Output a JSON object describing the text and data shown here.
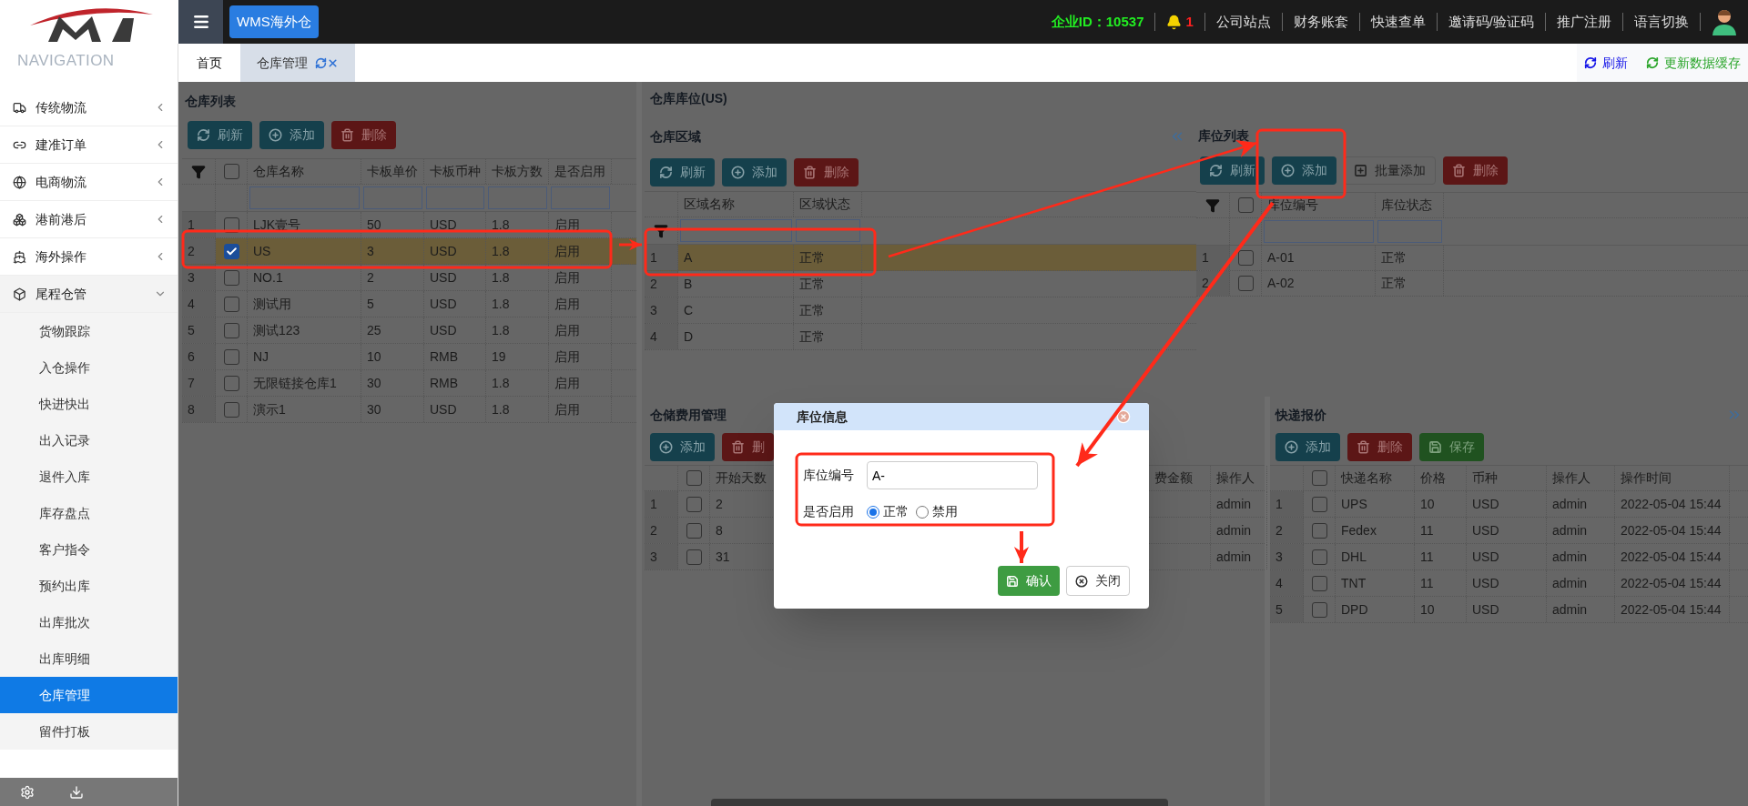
{
  "header": {
    "app_button": "WMS海外仓",
    "company_id": "企业ID：10537",
    "alert_count": "1",
    "links": [
      "公司站点",
      "财务账套",
      "快速查单",
      "邀请码/验证码",
      "推广注册",
      "语言切换"
    ]
  },
  "sidebar": {
    "title": "NAVIGATION",
    "items": [
      {
        "label": "传统物流",
        "expanded": false
      },
      {
        "label": "建准订单",
        "expanded": false
      },
      {
        "label": "电商物流",
        "expanded": false
      },
      {
        "label": "港前港后",
        "expanded": false
      },
      {
        "label": "海外操作",
        "expanded": false
      },
      {
        "label": "尾程仓管",
        "expanded": true,
        "children": [
          {
            "label": "货物跟踪",
            "selected": false
          },
          {
            "label": "入仓操作",
            "selected": false
          },
          {
            "label": "快进快出",
            "selected": false
          },
          {
            "label": "出入记录",
            "selected": false
          },
          {
            "label": "退件入库",
            "selected": false
          },
          {
            "label": "库存盘点",
            "selected": false
          },
          {
            "label": "客户指令",
            "selected": false
          },
          {
            "label": "预约出库",
            "selected": false
          },
          {
            "label": "出库批次",
            "selected": false
          },
          {
            "label": "出库明细",
            "selected": false
          },
          {
            "label": "仓库管理",
            "selected": true
          },
          {
            "label": "留件打板",
            "selected": false
          }
        ]
      }
    ]
  },
  "tabs": [
    {
      "label": "首页",
      "selected": false
    },
    {
      "label": "仓库管理",
      "selected": true
    }
  ],
  "tab_actions": [
    "刷新",
    "更新数据缓存"
  ],
  "warehouse_list": {
    "title": "仓库列表",
    "toolbar": [
      {
        "label": "刷新",
        "kind": "refresh"
      },
      {
        "label": "添加",
        "kind": "add"
      },
      {
        "label": "删除",
        "kind": "delete"
      }
    ],
    "table": {
      "all_checked": false,
      "columns": [
        "仓库名称",
        "卡板单价",
        "卡板币种",
        "卡板方数",
        "是否启用"
      ],
      "rows": [
        {
          "index": "1",
          "checked": false,
          "selected": false,
          "cells": [
            "LJK壹号",
            "50",
            "USD",
            "1.8",
            "启用"
          ]
        },
        {
          "index": "2",
          "checked": true,
          "selected": true,
          "cells": [
            "US",
            "3",
            "USD",
            "1.8",
            "启用"
          ]
        },
        {
          "index": "3",
          "checked": false,
          "selected": false,
          "cells": [
            "NO.1",
            "2",
            "USD",
            "1.8",
            "启用"
          ]
        },
        {
          "index": "4",
          "checked": false,
          "selected": false,
          "cells": [
            "测试用",
            "5",
            "USD",
            "1.8",
            "启用"
          ]
        },
        {
          "index": "5",
          "checked": false,
          "selected": false,
          "cells": [
            "测试123",
            "25",
            "USD",
            "1.8",
            "启用"
          ]
        },
        {
          "index": "6",
          "checked": false,
          "selected": false,
          "cells": [
            "NJ",
            "10",
            "RMB",
            "19",
            "启用"
          ]
        },
        {
          "index": "7",
          "checked": false,
          "selected": false,
          "cells": [
            "无限链接仓库1",
            "30",
            "RMB",
            "1.8",
            "启用"
          ]
        },
        {
          "index": "8",
          "checked": false,
          "selected": false,
          "cells": [
            "演示1",
            "30",
            "USD",
            "1.8",
            "启用"
          ]
        }
      ]
    }
  },
  "location_title": "仓库库位(US)",
  "areas": {
    "title": "仓库区域",
    "toolbar": [
      {
        "label": "刷新",
        "kind": "refresh"
      },
      {
        "label": "添加",
        "kind": "add"
      },
      {
        "label": "删除",
        "kind": "delete"
      }
    ],
    "table": {
      "columns": [
        "区域名称",
        "区域状态"
      ],
      "rows": [
        {
          "index": "1",
          "selected": true,
          "cells": [
            "A",
            "正常"
          ]
        },
        {
          "index": "2",
          "selected": false,
          "cells": [
            "B",
            "正常"
          ]
        },
        {
          "index": "3",
          "selected": false,
          "cells": [
            "C",
            "正常"
          ]
        },
        {
          "index": "4",
          "selected": false,
          "cells": [
            "D",
            "正常"
          ]
        }
      ]
    }
  },
  "locations": {
    "title": "库位列表",
    "toolbar": [
      {
        "label": "刷新",
        "kind": "refresh"
      },
      {
        "label": "添加",
        "kind": "add"
      },
      {
        "label": "批量添加",
        "kind": "batch"
      },
      {
        "label": "删除",
        "kind": "delete"
      }
    ],
    "table": {
      "all_checked": false,
      "columns": [
        "库位编号",
        "库位状态"
      ],
      "rows": [
        {
          "index": "1",
          "checked": false,
          "cells": [
            "A-01",
            "正常"
          ]
        },
        {
          "index": "2",
          "checked": false,
          "cells": [
            "A-02",
            "正常"
          ]
        }
      ]
    }
  },
  "fees": {
    "title": "仓储费用管理",
    "toolbar": [
      {
        "label": "添加",
        "kind": "add"
      },
      {
        "label": "删",
        "kind": "delete"
      }
    ],
    "table": {
      "all_checked": false,
      "columns": [
        "开始天数",
        "费金额",
        "操作人"
      ],
      "rows": [
        {
          "index": "1",
          "checked": false,
          "cells": [
            "2",
            "",
            "admin"
          ]
        },
        {
          "index": "2",
          "checked": false,
          "cells": [
            "8",
            "",
            "admin"
          ]
        },
        {
          "index": "3",
          "checked": false,
          "cells": [
            "31",
            "",
            "admin"
          ]
        }
      ]
    }
  },
  "express": {
    "title": "快递报价",
    "toolbar": [
      {
        "label": "添加",
        "kind": "add"
      },
      {
        "label": "删除",
        "kind": "delete"
      },
      {
        "label": "保存",
        "kind": "save"
      }
    ],
    "table": {
      "all_checked": false,
      "columns": [
        "快递名称",
        "价格",
        "币种",
        "操作人",
        "操作时间"
      ],
      "rows": [
        {
          "index": "1",
          "checked": false,
          "cells": [
            "UPS",
            "10",
            "USD",
            "admin",
            "2022-05-04 15:44"
          ]
        },
        {
          "index": "2",
          "checked": false,
          "cells": [
            "Fedex",
            "11",
            "USD",
            "admin",
            "2022-05-04 15:44"
          ]
        },
        {
          "index": "3",
          "checked": false,
          "cells": [
            "DHL",
            "11",
            "USD",
            "admin",
            "2022-05-04 15:44"
          ]
        },
        {
          "index": "4",
          "checked": false,
          "cells": [
            "TNT",
            "11",
            "USD",
            "admin",
            "2022-05-04 15:44"
          ]
        },
        {
          "index": "5",
          "checked": false,
          "cells": [
            "DPD",
            "10",
            "USD",
            "admin",
            "2022-05-04 15:44"
          ]
        }
      ]
    }
  },
  "dialog": {
    "title": "库位信息",
    "fields": [
      {
        "kind": "text",
        "label": "库位编号",
        "value": "A-"
      },
      {
        "kind": "radio",
        "label": "是否启用",
        "options": [
          {
            "label": "正常",
            "selected": true
          },
          {
            "label": "禁用",
            "selected": false
          }
        ]
      }
    ],
    "buttons": [
      {
        "label": "确认",
        "kind": "primary"
      },
      {
        "label": "关闭",
        "kind": "default"
      }
    ]
  }
}
